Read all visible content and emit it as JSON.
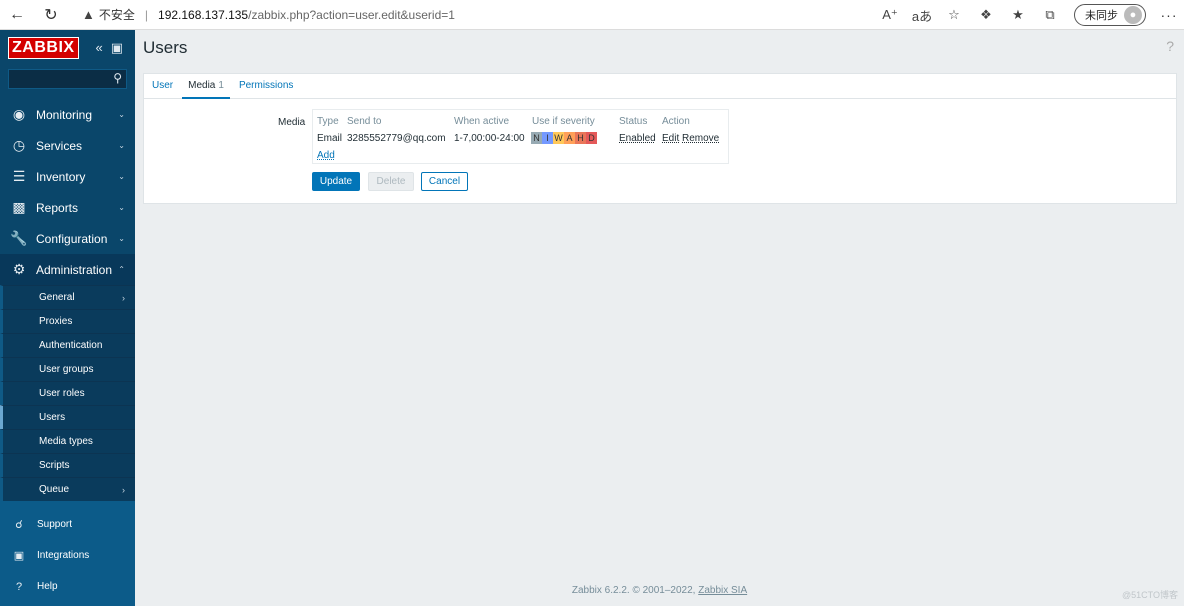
{
  "browser": {
    "insecure_label": "不安全",
    "url_host": "192.168.137.135",
    "url_path": "/zabbix.php?action=user.edit&userid=1",
    "sync_label": "未同步"
  },
  "sidebar": {
    "logo": "ZABBIX",
    "menu": [
      {
        "label": "Monitoring"
      },
      {
        "label": "Services"
      },
      {
        "label": "Inventory"
      },
      {
        "label": "Reports"
      },
      {
        "label": "Configuration"
      },
      {
        "label": "Administration"
      }
    ],
    "submenu": [
      {
        "label": "General"
      },
      {
        "label": "Proxies"
      },
      {
        "label": "Authentication"
      },
      {
        "label": "User groups"
      },
      {
        "label": "User roles"
      },
      {
        "label": "Users"
      },
      {
        "label": "Media types"
      },
      {
        "label": "Scripts"
      },
      {
        "label": "Queue"
      }
    ],
    "bottom": [
      {
        "label": "Support"
      },
      {
        "label": "Integrations"
      },
      {
        "label": "Help"
      }
    ]
  },
  "page": {
    "title": "Users",
    "help": "?"
  },
  "tabs": [
    {
      "label": "User"
    },
    {
      "label": "Media",
      "count": "1"
    },
    {
      "label": "Permissions"
    }
  ],
  "form": {
    "media_label": "Media",
    "headers": {
      "type": "Type",
      "send_to": "Send to",
      "when_active": "When active",
      "use_if_severity": "Use if severity",
      "status": "Status",
      "action": "Action"
    },
    "row": {
      "type": "Email",
      "send_to": "3285552779@qq.com",
      "when_active": "1-7,00:00-24:00",
      "severity": [
        {
          "letter": "N",
          "color": "#97aab3"
        },
        {
          "letter": "I",
          "color": "#7499ff"
        },
        {
          "letter": "W",
          "color": "#ffc859"
        },
        {
          "letter": "A",
          "color": "#ffa059"
        },
        {
          "letter": "H",
          "color": "#e97659"
        },
        {
          "letter": "D",
          "color": "#e45959"
        }
      ],
      "status": "Enabled",
      "edit": "Edit",
      "remove": "Remove"
    },
    "add": "Add",
    "buttons": {
      "update": "Update",
      "delete": "Delete",
      "cancel": "Cancel"
    }
  },
  "footer": {
    "text": "Zabbix 6.2.2. © 2001–2022,",
    "link": "Zabbix SIA"
  },
  "watermark": "@51CTO博客"
}
